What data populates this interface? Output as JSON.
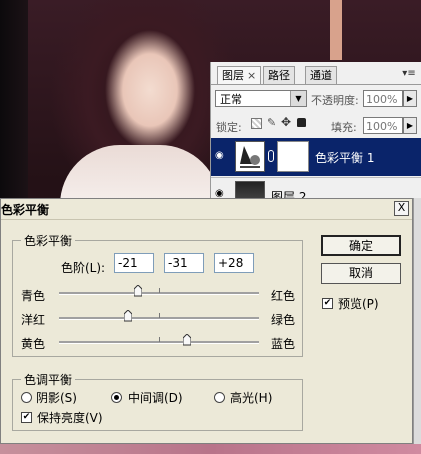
{
  "layers_panel": {
    "tabs": [
      {
        "label": "图层",
        "close": "×"
      },
      {
        "label": "路径"
      },
      {
        "label": "通道"
      }
    ],
    "menu_icon": "panel-menu-icon",
    "blend_mode": "正常",
    "opacity_label": "不透明度:",
    "opacity_value": "100%",
    "lock_label": "锁定:",
    "fill_label": "填充:",
    "fill_value": "100%",
    "layers": [
      {
        "name": "色彩平衡 1",
        "selected": true
      },
      {
        "name": "图层 2",
        "selected": false
      }
    ]
  },
  "dialog": {
    "title": "色彩平衡",
    "close_label": "X",
    "color_balance_group": "色彩平衡",
    "levels_label": "色阶(L):",
    "levels": [
      "-21",
      "-31",
      "+28"
    ],
    "sliders": [
      {
        "left": "青色",
        "right": "红色",
        "value": -21
      },
      {
        "left": "洋红",
        "right": "绿色",
        "value": -31
      },
      {
        "left": "黄色",
        "right": "蓝色",
        "value": 28
      }
    ],
    "tone_balance_group": "色调平衡",
    "tone_options": [
      {
        "label": "阴影(S)",
        "selected": false
      },
      {
        "label": "中间调(D)",
        "selected": true
      },
      {
        "label": "高光(H)",
        "selected": false
      }
    ],
    "preserve_luminosity": {
      "label": "保持亮度(V)",
      "checked": true
    },
    "ok_label": "确定",
    "cancel_label": "取消",
    "preview": {
      "label": "预览(P)",
      "checked": true
    }
  },
  "colors": {
    "selected_layer_bg": "#0a246a",
    "dialog_bg": "#ece9d8"
  }
}
